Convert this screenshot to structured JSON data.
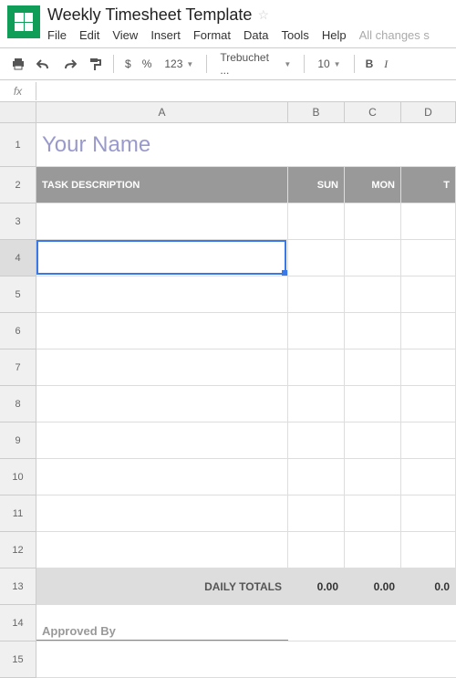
{
  "doc": {
    "title": "Weekly Timesheet Template"
  },
  "menu": {
    "file": "File",
    "edit": "Edit",
    "view": "View",
    "insert": "Insert",
    "format": "Format",
    "data": "Data",
    "tools": "Tools",
    "help": "Help",
    "status": "All changes s"
  },
  "toolbar": {
    "dollar": "$",
    "percent": "%",
    "num": "123",
    "font": "Trebuchet ...",
    "size": "10",
    "bold": "B",
    "italic": "I"
  },
  "fx": {
    "label": "fx"
  },
  "cols": {
    "A": "A",
    "B": "B",
    "C": "C",
    "D": "D"
  },
  "rows": [
    "1",
    "2",
    "3",
    "4",
    "5",
    "6",
    "7",
    "8",
    "9",
    "10",
    "11",
    "12",
    "13",
    "14",
    "15"
  ],
  "content": {
    "name": "Your Name",
    "hdr_task": "TASK DESCRIPTION",
    "hdr_sun": "SUN",
    "hdr_mon": "MON",
    "hdr_tue": "T",
    "totals_label": "DAILY TOTALS",
    "totals_sun": "0.00",
    "totals_mon": "0.00",
    "totals_tue": "0.0",
    "approved": "Approved By"
  },
  "selection": {
    "row": 4,
    "col": "A"
  }
}
